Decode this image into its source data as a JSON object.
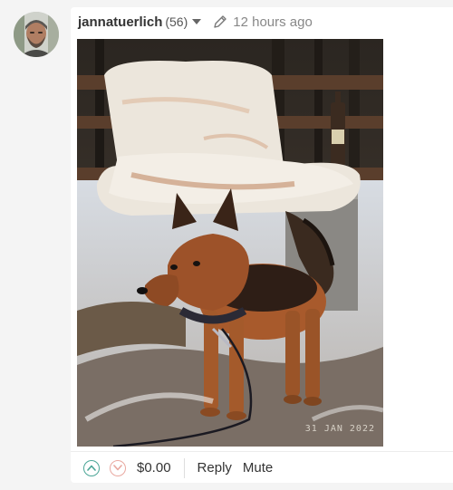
{
  "post": {
    "author": "jannatuerlich",
    "reputation": "(56)",
    "timestamp": "12 hours ago",
    "photo_date_stamp": "31 JAN 2022"
  },
  "actions": {
    "payout": "$0.00",
    "reply_label": "Reply",
    "mute_label": "Mute"
  },
  "icons": {
    "dropdown": "caret-down-icon",
    "edited": "pencil-icon",
    "upvote": "chevron-up-icon",
    "downvote": "chevron-down-icon"
  },
  "colors": {
    "upvote": "#4aa596",
    "downvote": "#e9a8a0",
    "muted_text": "#888888",
    "card_background": "#ffffff",
    "page_background": "#f4f4f4"
  }
}
